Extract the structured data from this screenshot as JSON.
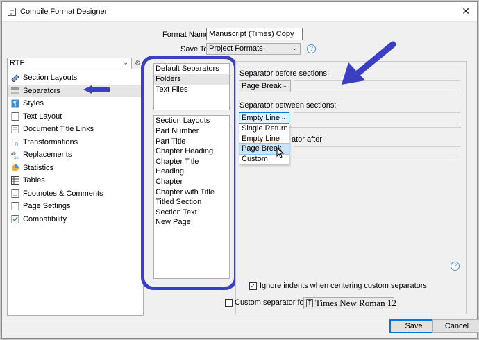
{
  "window": {
    "title": "Compile Format Designer",
    "close": "✕"
  },
  "format": {
    "name_label": "Format Name:",
    "name_value": "Manuscript (Times) Copy",
    "save_to_label": "Save To:",
    "save_to_value": "Project Formats"
  },
  "output_type": "RTF",
  "sidebar": {
    "items": [
      {
        "label": "Section Layouts",
        "icon": "section-layouts-icon"
      },
      {
        "label": "Separators",
        "icon": "separators-icon"
      },
      {
        "label": "Styles",
        "icon": "styles-icon"
      },
      {
        "label": "Text Layout",
        "icon": "text-layout-icon"
      },
      {
        "label": "Document Title Links",
        "icon": "title-links-icon"
      },
      {
        "label": "Transformations",
        "icon": "transformations-icon"
      },
      {
        "label": "Replacements",
        "icon": "replacements-icon"
      },
      {
        "label": "Statistics",
        "icon": "statistics-icon"
      },
      {
        "label": "Tables",
        "icon": "tables-icon"
      },
      {
        "label": "Footnotes & Comments",
        "icon": "footnotes-icon"
      },
      {
        "label": "Page Settings",
        "icon": "page-settings-icon"
      },
      {
        "label": "Compatibility",
        "icon": "compatibility-icon"
      }
    ]
  },
  "default_separators": {
    "header": "Default Separators",
    "items": [
      "Folders",
      "Text Files"
    ]
  },
  "section_layouts": {
    "header": "Section Layouts",
    "items": [
      "Part Number",
      "Part Title",
      "Chapter Heading",
      "Chapter Title",
      "Heading",
      "Chapter",
      "Chapter with Title",
      "Titled Section",
      "Section Text",
      "New Page"
    ]
  },
  "separators": {
    "before_label": "Separator before sections:",
    "before_value": "Page Break",
    "between_label": "Separator between sections:",
    "between_value": "Empty Line",
    "after_label_visible": "ator after:",
    "options": [
      "Single Return",
      "Empty Line",
      "Page Break",
      "Custom"
    ]
  },
  "ignore_indents": {
    "label": "Ignore indents when centering custom separators",
    "checked": true
  },
  "custom_font": {
    "label": "Custom separator font",
    "checked": false,
    "font": "Times New Roman 12"
  },
  "buttons": {
    "save": "Save",
    "cancel": "Cancel"
  },
  "colors": {
    "annotation": "#3a3fc4",
    "hover": "#cce4f7"
  }
}
